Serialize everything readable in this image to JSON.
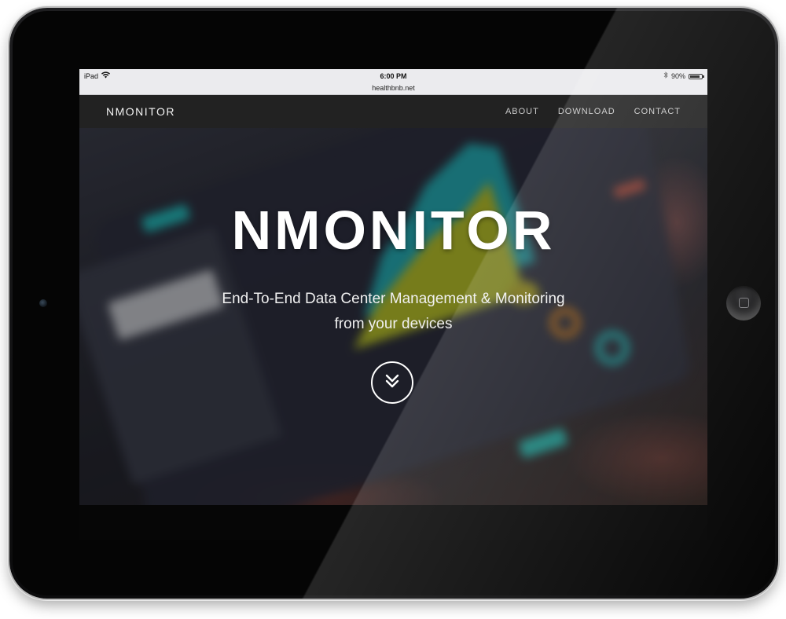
{
  "status_bar": {
    "device": "iPad",
    "time": "6:00 PM",
    "battery": "90%",
    "battery_level": 0.9,
    "icons": [
      "wifi-icon",
      "bluetooth-icon",
      "battery-icon"
    ]
  },
  "browser": {
    "url": "healthbnb.net"
  },
  "nav": {
    "brand": "NMONITOR",
    "links": [
      "ABOUT",
      "DOWNLOAD",
      "CONTACT"
    ]
  },
  "hero": {
    "title": "NMONITOR",
    "subtitle_line1": "End-To-End Data Center Management & Monitoring",
    "subtitle_line2": "from your devices",
    "scroll_icon": "double-chevron-down-icon"
  },
  "device_frame": {
    "icons": [
      "camera-icon",
      "home-button-icon"
    ]
  },
  "colors": {
    "status_bar_bg": "#ebebee",
    "navbar_bg": "#222222",
    "nav_link": "#c9c9c9",
    "hero_text": "#ffffff",
    "accent_cyan": "#24c6c6",
    "accent_yellow": "#c6d02a",
    "accent_orange": "#d07a1a"
  }
}
